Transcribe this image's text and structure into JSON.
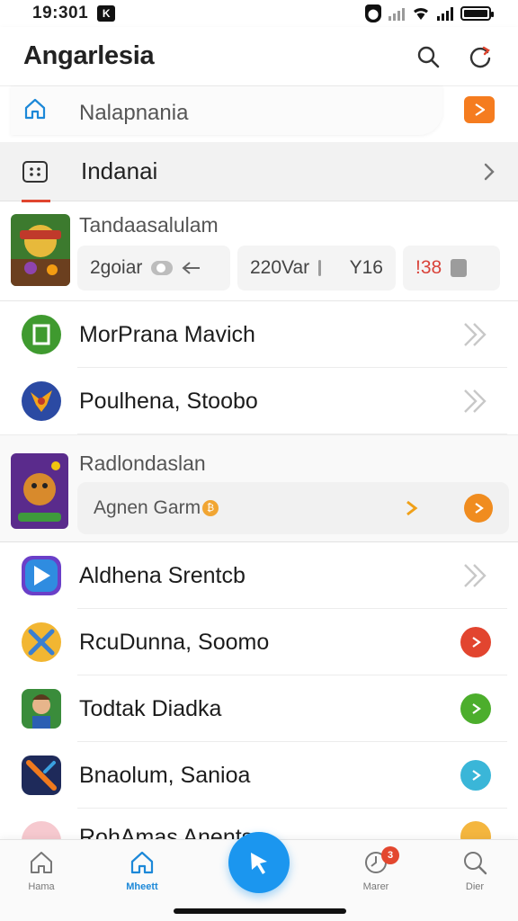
{
  "status": {
    "time": "19:301",
    "badge": "K"
  },
  "header": {
    "title": "Angarlesia"
  },
  "nav1": {
    "label": "Nalapnania"
  },
  "nav2": {
    "label": "Indanai"
  },
  "featured1": {
    "title": "Tandaasalulam",
    "chip1": "2goiar",
    "chip2": "220Var",
    "chip3": "Y16",
    "chip4": "!38"
  },
  "rows_a": [
    {
      "label": "MorPrana Mavich",
      "icon": "green-square-app-icon"
    },
    {
      "label": "Poulhena, Stoobo",
      "icon": "fox-app-icon"
    }
  ],
  "featured2": {
    "title": "Radlondaslan",
    "bar_text": "Agnen Garm"
  },
  "rows_b": [
    {
      "label": "Aldhena Srentcb",
      "icon": "play-store-app-icon",
      "action_color": ""
    },
    {
      "label": "RcuDunna, Soomo",
      "icon": "crossed-swords-app-icon",
      "action_color": "#e2452f"
    },
    {
      "label": "Todtak Diadka",
      "icon": "hero-app-icon",
      "action_color": "#4cae2c"
    },
    {
      "label": "Bnaolum, Sanioa",
      "icon": "sword-app-icon",
      "action_color": "#3ab6d8"
    }
  ],
  "partial_row": {
    "label": "RohAmas Anents"
  },
  "bottom_nav": {
    "tabs": [
      "Hama",
      "Mheett",
      "Marer",
      "Dier"
    ],
    "notif_count": "3"
  },
  "colors": {
    "accent_blue": "#1b96ef",
    "accent_orange": "#f57c1f",
    "accent_red": "#e0452f"
  }
}
